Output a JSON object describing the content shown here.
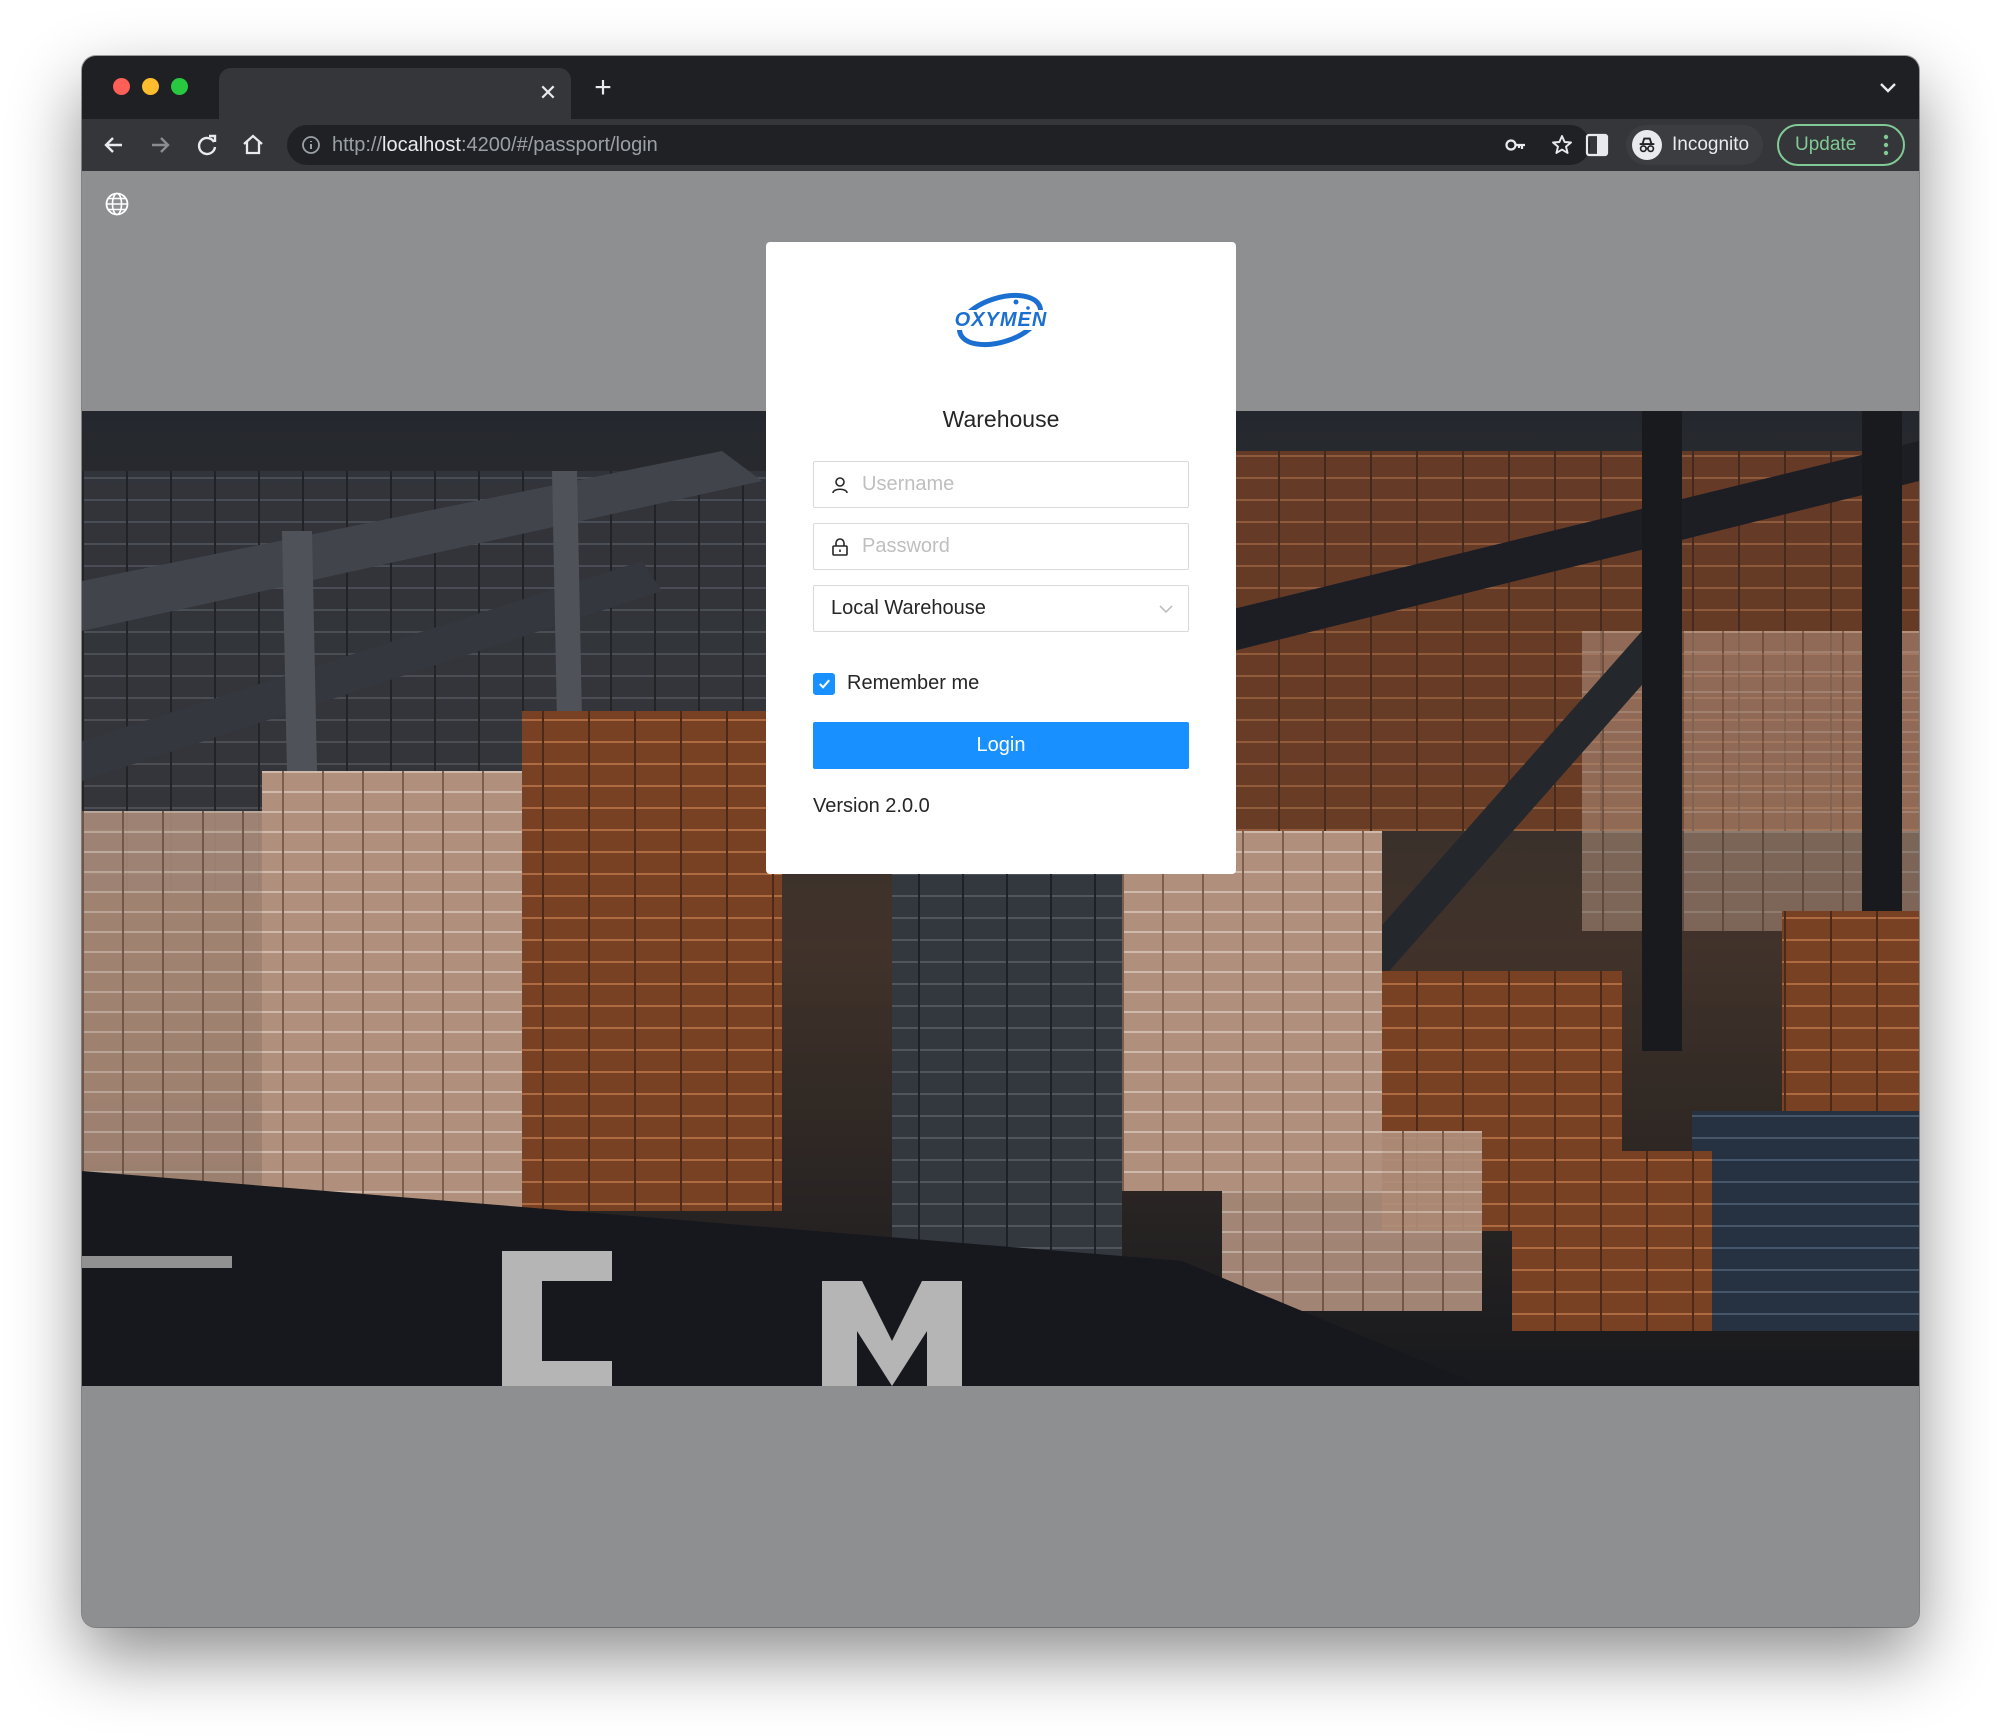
{
  "browser": {
    "tab_title": "",
    "url_scheme": "http://",
    "url_host": "localhost",
    "url_path": ":4200/#/passport/login",
    "profile_label": "Incognito",
    "update_label": "Update"
  },
  "login": {
    "title": "Warehouse",
    "logo_text": "OXYMEN",
    "username_placeholder": "Username",
    "password_placeholder": "Password",
    "warehouse_selected": "Local Warehouse",
    "remember_label": "Remember me",
    "remember_checked": true,
    "login_label": "Login",
    "version": "Version 2.0.0"
  },
  "colors": {
    "primary": "#1890ff",
    "update": "#81c995",
    "page_overlay": "#8e8f91"
  }
}
